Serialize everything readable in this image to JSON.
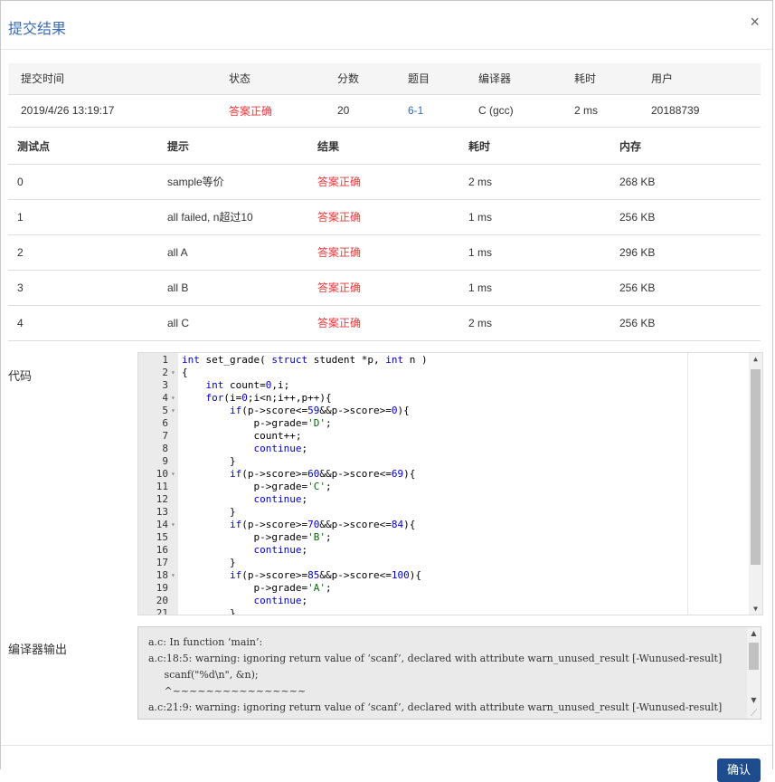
{
  "dialog": {
    "title": "提交结果",
    "close": "×"
  },
  "submission": {
    "headers": [
      "提交时间",
      "状态",
      "分数",
      "题目",
      "编译器",
      "耗时",
      "用户"
    ],
    "row": {
      "time": "2019/4/26 13:19:17",
      "status": "答案正确",
      "score": "20",
      "problem": "6-1",
      "compiler": "C (gcc)",
      "elapsed": "2 ms",
      "user": "20188739"
    }
  },
  "tests": {
    "headers": [
      "测试点",
      "提示",
      "结果",
      "耗时",
      "内存"
    ],
    "rows": [
      {
        "id": "0",
        "hint": "sample等价",
        "result": "答案正确",
        "time": "2 ms",
        "memory": "268 KB"
      },
      {
        "id": "1",
        "hint": "all failed, n超过10",
        "result": "答案正确",
        "time": "1 ms",
        "memory": "256 KB"
      },
      {
        "id": "2",
        "hint": "all A",
        "result": "答案正确",
        "time": "1 ms",
        "memory": "296 KB"
      },
      {
        "id": "3",
        "hint": "all B",
        "result": "答案正确",
        "time": "1 ms",
        "memory": "256 KB"
      },
      {
        "id": "4",
        "hint": "all C",
        "result": "答案正确",
        "time": "2 ms",
        "memory": "256 KB"
      }
    ]
  },
  "code": {
    "label": "代码",
    "folds": [
      2,
      4,
      5,
      10,
      14,
      18
    ],
    "lines": [
      "int set_grade( struct student *p, int n )",
      "{",
      "    int count=0,i;",
      "    for(i=0;i<n;i++,p++){",
      "        if(p->score<=59&&p->score>=0){",
      "            p->grade='D';",
      "            count++;",
      "            continue;",
      "        }",
      "        if(p->score>=60&&p->score<=69){",
      "            p->grade='C';",
      "            continue;",
      "        }",
      "        if(p->score>=70&&p->score<=84){",
      "            p->grade='B';",
      "            continue;",
      "        }",
      "        if(p->score>=85&&p->score<=100){",
      "            p->grade='A';",
      "            continue;",
      "        }"
    ],
    "line_count": 21
  },
  "compiler_output": {
    "label": "编译器输出",
    "text": "a.c: In function ‘main’:\na.c:18:5: warning: ignoring return value of ‘scanf’, declared with attribute warn_unused_result [-Wunused-result]\n     scanf(\"%d\\n\", &n);\n     ^~~~~~~~~~~~~~~~~\na.c:21:9: warning: ignoring return value of ‘scanf’, declared with attribute warn_unused_result [-Wunused-result]"
  },
  "footer": {
    "ok_label": "确认"
  }
}
